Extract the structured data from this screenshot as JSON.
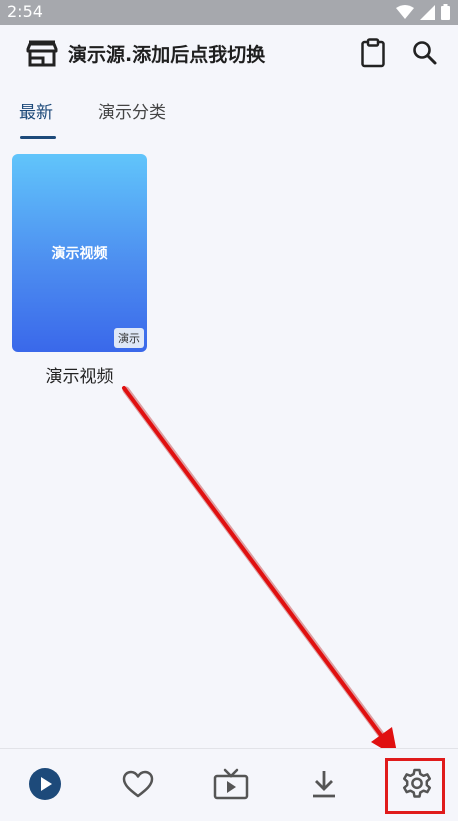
{
  "status": {
    "time": "2:54"
  },
  "header": {
    "title": "演示源.添加后点我切换"
  },
  "tabs": [
    {
      "label": "最新"
    },
    {
      "label": "演示分类"
    }
  ],
  "videos": [
    {
      "thumb_text": "演示视频",
      "badge": "演示",
      "title": "演示视频"
    }
  ],
  "bottom_nav": [
    {
      "icon": "play-circle-icon",
      "selected": true
    },
    {
      "icon": "heart-icon"
    },
    {
      "icon": "tv-icon"
    },
    {
      "icon": "download-icon"
    },
    {
      "icon": "gear-icon"
    }
  ],
  "colors": {
    "accent": "#1d4a7a",
    "highlight": "#e01b1b"
  }
}
